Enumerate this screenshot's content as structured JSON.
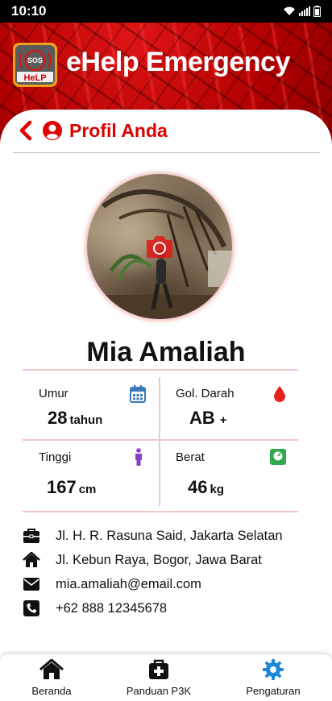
{
  "status_bar": {
    "time": "10:10"
  },
  "header": {
    "app_title": "eHelp Emergency",
    "logo_text_top": "SOS",
    "logo_text_bottom": "HeLP"
  },
  "page": {
    "title": "Profil Anda"
  },
  "profile": {
    "name": "Mia Amaliah",
    "stats": {
      "age": {
        "label": "Umur",
        "value": "28",
        "unit": "tahun"
      },
      "blood": {
        "label": "Gol. Darah",
        "value": "AB",
        "unit": "+"
      },
      "height": {
        "label": "Tinggi",
        "value": "167",
        "unit": "cm"
      },
      "weight": {
        "label": "Berat",
        "value": "46",
        "unit": "kg"
      }
    },
    "contacts": {
      "office_address": "Jl. H. R. Rasuna Said, Jakarta Selatan",
      "home_address": "Jl. Kebun Raya, Bogor, Jawa Barat",
      "email": "mia.amaliah@email.com",
      "phone": "+62 888 12345678"
    }
  },
  "bottom_nav": {
    "items": [
      {
        "label": "Beranda",
        "icon": "home-icon"
      },
      {
        "label": "Panduan P3K",
        "icon": "first-aid-kit-icon"
      },
      {
        "label": "Pengaturan",
        "icon": "gear-icon",
        "active": true
      }
    ]
  },
  "colors": {
    "brand_red": "#e00000",
    "calendar_icon": "#3a7ab8",
    "blood_icon": "#e52020",
    "person_icon": "#8a3fc7",
    "scale_icon": "#2ea84a",
    "active_nav": "#1c86d8"
  }
}
